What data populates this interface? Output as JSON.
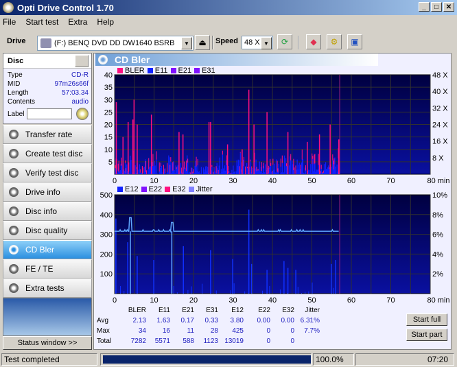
{
  "window": {
    "title": "Opti Drive Control 1.70",
    "minimize": "_",
    "maximize": "□",
    "close": "✕"
  },
  "menu": [
    "File",
    "Start test",
    "Extra",
    "Help"
  ],
  "toolbar": {
    "drive_label": "Drive",
    "drive_value": "(F:)   BENQ DVD DD DW1640 BSRB",
    "speed_label": "Speed",
    "speed_value": "48 X",
    "icons": [
      "eject-icon",
      "refresh-icon",
      "eraser-icon",
      "settings-icon",
      "save-icon"
    ]
  },
  "disc": {
    "header": "Disc",
    "rows": [
      {
        "k": "Type",
        "v": "CD-R"
      },
      {
        "k": "MID",
        "v": "97m26s66f"
      },
      {
        "k": "Length",
        "v": "57:03.34"
      },
      {
        "k": "Contents",
        "v": "audio"
      }
    ],
    "label_label": "Label",
    "label_value": ""
  },
  "nav": [
    {
      "label": "Transfer rate",
      "active": false
    },
    {
      "label": "Create test disc",
      "active": false
    },
    {
      "label": "Verify test disc",
      "active": false
    },
    {
      "label": "Drive info",
      "active": false
    },
    {
      "label": "Disc info",
      "active": false
    },
    {
      "label": "Disc quality",
      "active": false
    },
    {
      "label": "CD Bler",
      "active": true
    },
    {
      "label": "FE / TE",
      "active": false
    },
    {
      "label": "Extra tests",
      "active": false
    }
  ],
  "status_window_button": "Status window >>",
  "main": {
    "title": "CD Bler"
  },
  "chart_data": [
    {
      "type": "bar",
      "title": "",
      "legend": [
        {
          "name": "BLER",
          "color": "#ff1080"
        },
        {
          "name": "E11",
          "color": "#1020ff"
        },
        {
          "name": "E21",
          "color": "#8010ff"
        },
        {
          "name": "E31",
          "color": "#8010ff"
        }
      ],
      "xlabel": "min",
      "xlim": [
        0,
        80
      ],
      "x_ticks": [
        0,
        10,
        20,
        30,
        40,
        50,
        60,
        70,
        80
      ],
      "ylim": [
        0,
        40
      ],
      "y_ticks": [
        5,
        10,
        15,
        20,
        25,
        30,
        35,
        40
      ],
      "y2_ticks": [
        "8 X",
        "16 X",
        "24 X",
        "32 X",
        "40 X",
        "48 X"
      ],
      "end_marker_min": 57.05,
      "bler_peaks": [
        [
          0.3,
          29
        ],
        [
          4.8,
          30
        ],
        [
          2.0,
          15
        ],
        [
          3.3,
          21
        ],
        [
          4.5,
          22
        ],
        [
          5.6,
          20
        ],
        [
          9.2,
          24
        ],
        [
          16.2,
          17
        ],
        [
          17.2,
          16
        ],
        [
          23.8,
          21
        ],
        [
          24.2,
          21
        ],
        [
          28.5,
          12
        ],
        [
          32.2,
          10
        ],
        [
          33.9,
          34
        ],
        [
          35.2,
          20
        ],
        [
          38.5,
          25
        ],
        [
          43.8,
          17
        ],
        [
          48.7,
          13
        ],
        [
          51.8,
          16
        ],
        [
          54.5,
          20
        ],
        [
          56.7,
          14
        ]
      ],
      "grid": true
    },
    {
      "type": "bar",
      "legend": [
        {
          "name": "E12",
          "color": "#1020ff"
        },
        {
          "name": "E22",
          "color": "#8010ff"
        },
        {
          "name": "E32",
          "color": "#ff1080"
        },
        {
          "name": "Jitter",
          "color": "#8080ff"
        }
      ],
      "xlabel": "min",
      "xlim": [
        0,
        80
      ],
      "x_ticks": [
        0,
        10,
        20,
        30,
        40,
        50,
        60,
        70,
        80
      ],
      "ylim": [
        0,
        500
      ],
      "y_ticks": [
        100,
        200,
        300,
        400,
        500
      ],
      "y2_ticks": [
        "2%",
        "4%",
        "6%",
        "8%",
        "10%"
      ],
      "y2lim": [
        0,
        10
      ],
      "jitter_baseline_pct": 6.31,
      "jitter_peaks": [
        [
          4.0,
          7.7
        ],
        [
          14.5,
          7.2
        ]
      ],
      "e12_peaks": [
        [
          0.2,
          380
        ],
        [
          3.2,
          260
        ],
        [
          5.6,
          190
        ],
        [
          9.8,
          170
        ],
        [
          17.3,
          240
        ],
        [
          24.2,
          220
        ],
        [
          29.8,
          175
        ],
        [
          33.9,
          425
        ],
        [
          34.6,
          150
        ],
        [
          38.5,
          120
        ],
        [
          42.8,
          165
        ],
        [
          43.8,
          130
        ],
        [
          45.8,
          120
        ],
        [
          54.8,
          150
        ],
        [
          55.9,
          170
        ]
      ],
      "end_marker_min": 57.05,
      "grid": true
    }
  ],
  "stats": {
    "columns": [
      "",
      "BLER",
      "E11",
      "E21",
      "E31",
      "E12",
      "E22",
      "E32",
      "Jitter"
    ],
    "rows": [
      [
        "Avg",
        "2.13",
        "1.63",
        "0.17",
        "0.33",
        "3.80",
        "0.00",
        "0.00",
        "6.31%"
      ],
      [
        "Max",
        "34",
        "16",
        "11",
        "28",
        "425",
        "0",
        "0",
        "7.7%"
      ],
      [
        "Total",
        "7282",
        "5571",
        "588",
        "1123",
        "13019",
        "0",
        "0",
        ""
      ]
    ]
  },
  "buttons": {
    "start_full": "Start full",
    "start_part": "Start part"
  },
  "statusbar": {
    "status": "Test completed",
    "progress_pct": 100,
    "progress_text": "100.0%",
    "time": "07:20"
  }
}
